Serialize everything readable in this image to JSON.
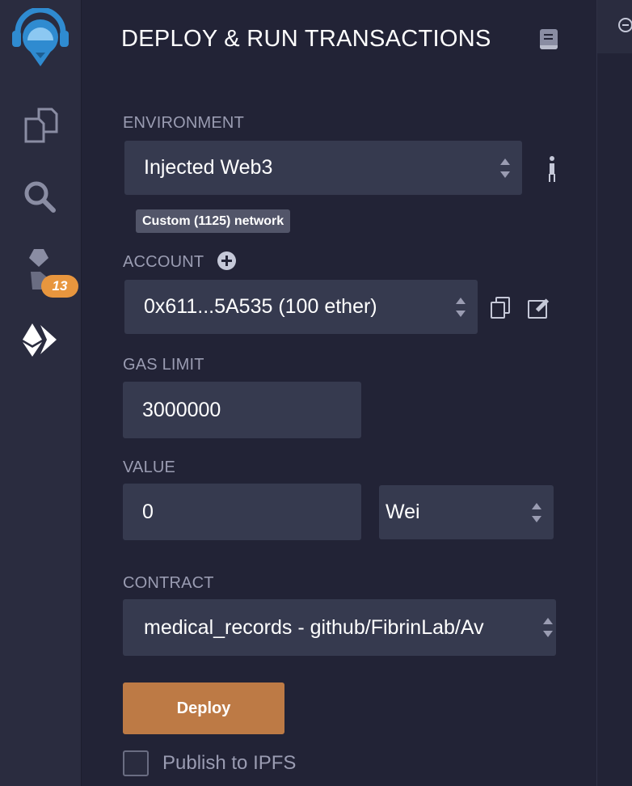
{
  "sidebar": {
    "icons": [
      "remix-logo-icon",
      "file-explorer-icon",
      "search-icon",
      "solidity-compiler-icon",
      "deploy-run-icon"
    ],
    "compiler_badge": "13"
  },
  "panel": {
    "title": "DEPLOY & RUN TRANSACTIONS",
    "environment": {
      "label": "ENVIRONMENT",
      "value": "Injected Web3",
      "network_badge": "Custom (1125) network"
    },
    "account": {
      "label": "ACCOUNT",
      "value": "0x611...5A535 (100 ether)"
    },
    "gas_limit": {
      "label": "GAS LIMIT",
      "value": "3000000"
    },
    "value": {
      "label": "VALUE",
      "amount": "0",
      "unit": "Wei"
    },
    "contract": {
      "label": "CONTRACT",
      "value": "medical_records - github/FibrinLab/Av"
    },
    "deploy_label": "Deploy",
    "publish_label": "Publish to IPFS"
  },
  "colors": {
    "background": "#222336",
    "rail": "#2a2c3f",
    "field": "#363a4f",
    "deploy": "#bd7a45",
    "badge": "#e8963e",
    "logo": "#2f8bd0"
  }
}
